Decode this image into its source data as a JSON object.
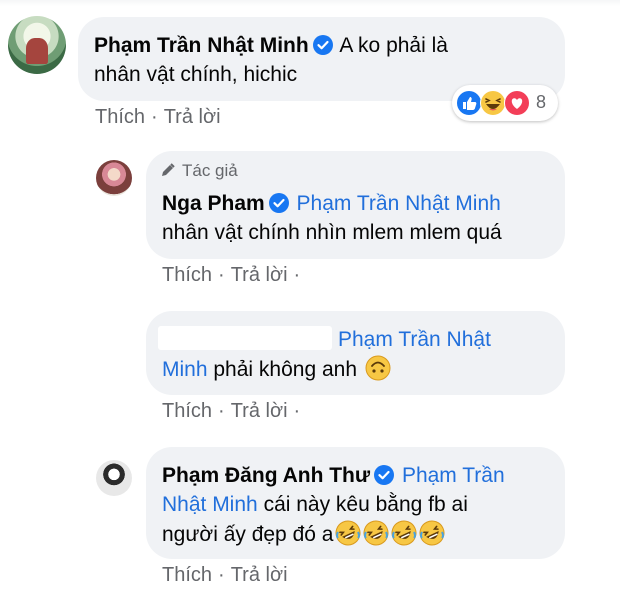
{
  "comments": [
    {
      "author": "Phạm Trần Nhật Minh",
      "verified": true,
      "lines": [
        "A ko phải là",
        "nhân vật chính, hichic"
      ],
      "actions": {
        "like": "Thích",
        "reply": "Trả lời",
        "separator": "·"
      },
      "reactions": {
        "types": [
          "like-icon",
          "haha-icon",
          "love-icon"
        ],
        "count": "8"
      }
    },
    {
      "author_label": "Tác giả",
      "author": "Nga Pham",
      "verified": true,
      "tag": "Phạm Trần Nhật Minh",
      "text": "nhân vật chính nhìn mlem mlem quá",
      "actions": {
        "like": "Thích",
        "reply": "Trả lời",
        "separator": "·"
      }
    },
    {
      "author": "",
      "tag_line1": "Phạm Trần Nhật",
      "tag_line2": "Minh",
      "text": "phải không anh",
      "emoji": "upside-down-face-icon",
      "actions": {
        "like": "Thích",
        "reply": "Trả lời",
        "separator": "·"
      }
    },
    {
      "author": "Phạm Đăng Anh Thư",
      "verified": true,
      "tag_line1": "Phạm Trần",
      "tag_line2": "Nhật Minh",
      "text_line2": "cái này kêu bằng fb ai",
      "text_line3": "người ấy đẹp đó a",
      "emoji": "rolling-on-floor-laughing-icon",
      "emoji_count": 4,
      "actions": {
        "like": "Thích",
        "reply": "Trả lời",
        "separator": "·"
      }
    }
  ],
  "colors": {
    "bubble": "#f0f2f5",
    "tag": "#216fdb",
    "verified": "#1877f2",
    "muted": "#65676b"
  }
}
